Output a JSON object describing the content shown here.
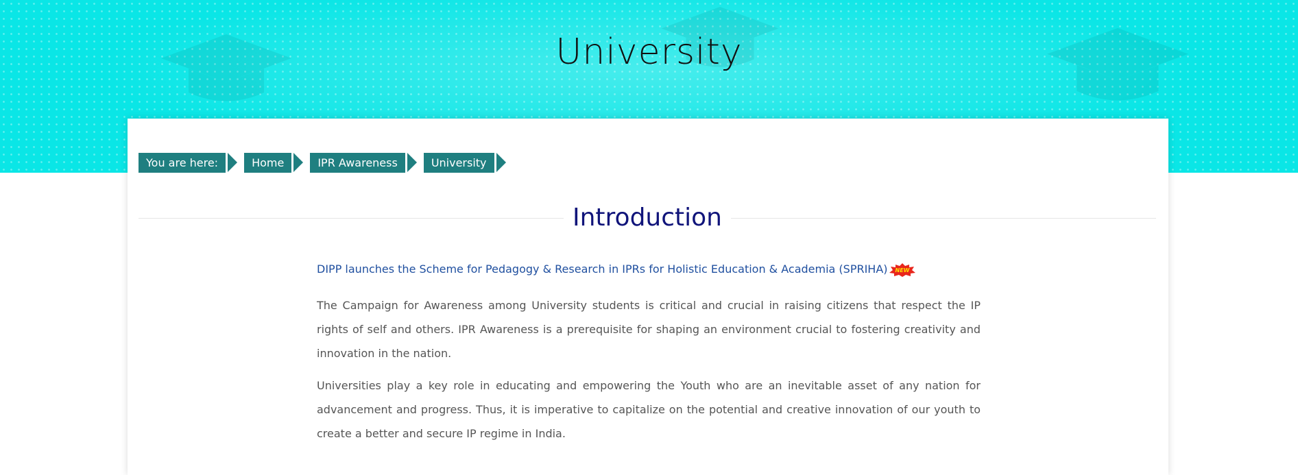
{
  "page": {
    "title": "University"
  },
  "breadcrumb": {
    "items": [
      {
        "label": "You are here:"
      },
      {
        "label": "Home"
      },
      {
        "label": "IPR Awareness"
      },
      {
        "label": "University"
      }
    ]
  },
  "section": {
    "title": "Introduction"
  },
  "content": {
    "news_link": "DIPP launches the Scheme for Pedagogy & Research in IPRs for Holistic Education & Academia (SPRIHA)",
    "new_badge": "NEW",
    "paragraphs": [
      "The Campaign for Awareness among University students is critical and crucial in raising citizens that respect the IP rights of self and others. IPR Awareness is a prerequisite for shaping an environment crucial to fostering creativity and innovation in the nation.",
      "Universities play a key role in educating and empowering the Youth who are an inevitable asset of any nation for advancement and progress. Thus, it is imperative to capitalize on the potential and creative innovation of our youth to create a better and secure IP regime in India."
    ]
  },
  "colors": {
    "hero_bg": "#0ae6e6",
    "breadcrumb_bg": "#1f7f80",
    "section_title": "#10147a",
    "link": "#1f4f9f",
    "body_text": "#555555",
    "badge_red": "#e8261c",
    "badge_yellow": "#ffe000"
  },
  "icons": {
    "hero_decoration": "graduation-cap-icon",
    "badge": "new-badge-icon"
  }
}
